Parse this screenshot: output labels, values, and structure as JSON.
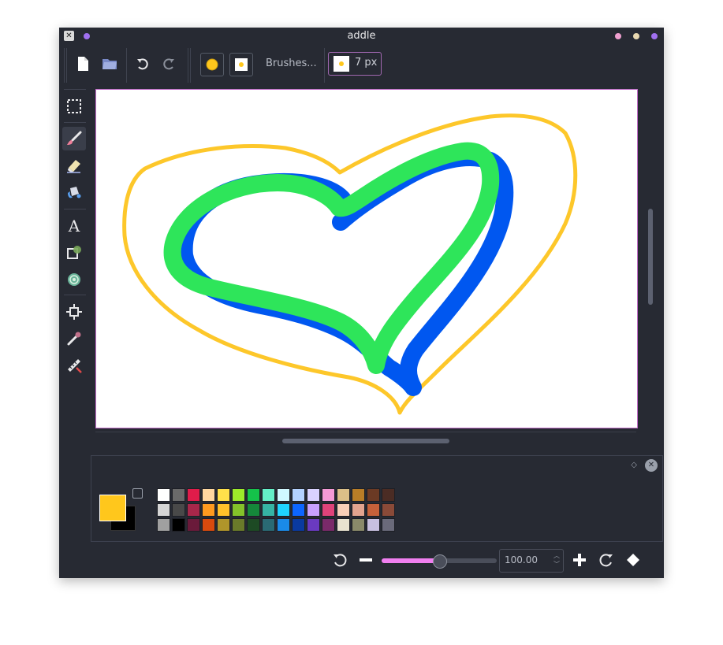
{
  "window": {
    "title": "addle",
    "app_icon": "x-app-icon",
    "title_dots": [
      "#a070f0",
      "#f0a0d0",
      "#e8d8b0",
      "#a070f0"
    ]
  },
  "toolbar": {
    "brushes_label": "Brushes...",
    "size_label": "7 px"
  },
  "tools": [
    {
      "name": "rect-select-icon",
      "active": false
    },
    {
      "name": "paintbrush-icon",
      "active": true
    },
    {
      "name": "eraser-icon",
      "active": false
    },
    {
      "name": "fill-bucket-icon",
      "active": false
    },
    {
      "name": "text-icon",
      "active": false
    },
    {
      "name": "shape-icon",
      "active": false
    },
    {
      "name": "gradient-icon",
      "active": false
    },
    {
      "name": "move-icon",
      "active": false
    },
    {
      "name": "color-picker-icon",
      "active": false
    },
    {
      "name": "measure-icon",
      "active": false
    }
  ],
  "colors": {
    "foreground": "#ffc71c",
    "background": "#000000",
    "accent": "#c06cc8",
    "stroke_yellow": "#fdc72a",
    "stroke_blue": "#0057f0",
    "stroke_green": "#2ee55a"
  },
  "palette": [
    [
      "#ffffff",
      "#6a6a6a",
      "#e01c4a",
      "#ffd7a0",
      "#ffe14a",
      "#9dea2a",
      "#15c24a",
      "#64f0c8",
      "#cff8ff",
      "#b4d2ff",
      "#d9d2ff",
      "#f49ad6",
      "#dbbf88",
      "#b87d27",
      "#6b3a24",
      "#4b2c24"
    ],
    [
      "#d5d5d5",
      "#494949",
      "#a8274a",
      "#ff9a1f",
      "#ffc12a",
      "#84c22a",
      "#15883a",
      "#36b4a4",
      "#1fd4ff",
      "#0d66ff",
      "#c8a0ff",
      "#e0437a",
      "#f8cfb8",
      "#e3a48f",
      "#c5613a",
      "#8a4a38"
    ],
    [
      "#a0a0a0",
      "#000000",
      "#6a1a3a",
      "#d84a0d",
      "#b0952a",
      "#6a7a2a",
      "#1d4a24",
      "#2a6a74",
      "#1a8ae8",
      "#0a3aa0",
      "#6a3ac0",
      "#7a2a6a",
      "#e8e2cf",
      "#8a8a6a",
      "#c8c0e0",
      "#6a6a7a"
    ]
  ],
  "zoom": {
    "value": "100.00",
    "slider_fraction": 0.5
  }
}
